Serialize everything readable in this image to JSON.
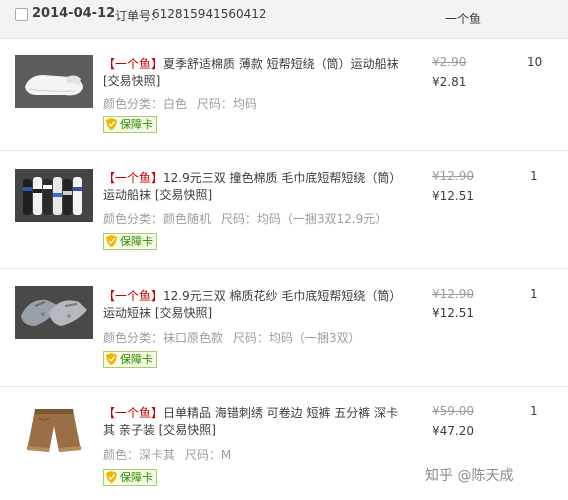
{
  "order": {
    "date": "2014-04-12",
    "number_label": "订单号:",
    "number": "612815941560412",
    "shop_name": "一个鱼"
  },
  "items": [
    {
      "shop_tag": "【一个鱼】",
      "title": "夏季舒适棉质 薄款 短帮短绕（筒）运动船袜 [交易快照]",
      "attrs": [
        "颜色分类：白色",
        "尺码：均码"
      ],
      "badge": "保障卡",
      "orig_price": "¥2.90",
      "price": "¥2.81",
      "quantity": "10"
    },
    {
      "shop_tag": "【一个鱼】",
      "title": "12.9元三双 撞色棉质 毛巾底短帮短绕（筒）运动船袜 [交易快照]",
      "attrs": [
        "颜色分类：颜色随机",
        "尺码：均码（一捆3双12.9元）"
      ],
      "badge": "保障卡",
      "orig_price": "¥12.90",
      "price": "¥12.51",
      "quantity": "1"
    },
    {
      "shop_tag": "【一个鱼】",
      "title": "12.9元三双 棉质花纱 毛巾底短帮短绕（筒）运动短袜 [交易快照]",
      "attrs": [
        "颜色分类：袜口原色款",
        "尺码：均码（一捆3双）"
      ],
      "badge": "保障卡",
      "orig_price": "¥12.90",
      "price": "¥12.51",
      "quantity": "1"
    },
    {
      "shop_tag": "【一个鱼】",
      "title": "日单精品 海错刺绣 可卷边 短裤 五分裤 深卡其 亲子装 [交易快照]",
      "attrs": [
        "颜色：深卡其",
        "尺码：M"
      ],
      "badge": "保障卡",
      "orig_price": "¥59.00",
      "price": "¥47.20",
      "quantity": "1"
    }
  ],
  "watermark": "知乎 @陈天成",
  "colors": {
    "shop_tag": "#c40000",
    "badge_text": "#2d8a00",
    "header_bg": "#f3f3f3"
  }
}
